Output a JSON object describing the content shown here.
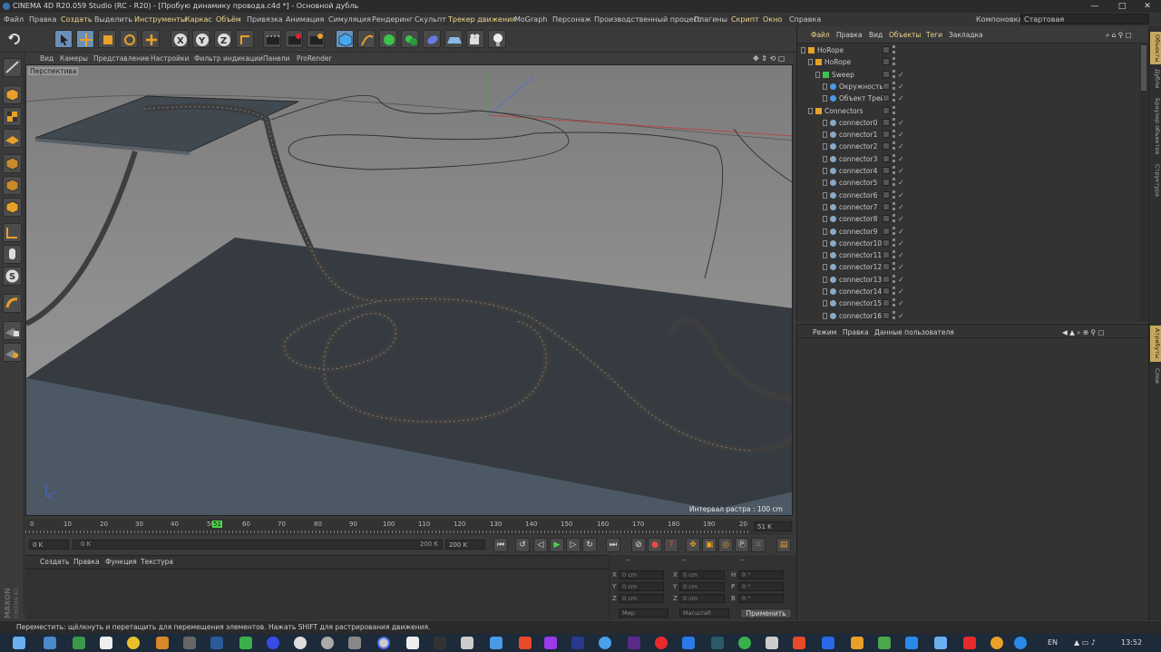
{
  "window": {
    "title": "CINEMA 4D R20.059 Studio (RC - R20) - [Пробую динамику провода.c4d *] - Основной дубль",
    "controls": [
      "—",
      "□",
      "✕"
    ]
  },
  "menu": {
    "items": [
      "Файл",
      "Правка",
      "Создать",
      "Выделить",
      "Инструменты",
      "Каркас",
      "Объём",
      "Привязка",
      "Анимация",
      "Симуляция",
      "Рендеринг",
      "Скульпт",
      "Трекер движения",
      "MoGraph",
      "Персонаж",
      "Производственный процесс",
      "Плагины",
      "Скрипт",
      "Окно",
      "Справка"
    ],
    "layout_label": "Компоновка",
    "layout_value": "Стартовая"
  },
  "viewport": {
    "menu": [
      "Вид",
      "Камеры",
      "Представление",
      "Настройки",
      "Фильтр индикации",
      "Панели",
      "ProRender"
    ],
    "label": "Перспектива",
    "grid_label": "Интервал растра : 100 cm"
  },
  "timeline": {
    "ticks": [
      "0",
      "10",
      "20",
      "30",
      "40",
      "50",
      "51",
      "60",
      "70",
      "80",
      "90",
      "100",
      "110",
      "120",
      "130",
      "140",
      "150",
      "160",
      "170",
      "180",
      "190",
      "20"
    ],
    "current_frame": "51 K",
    "start_field": "0 K",
    "range_start": "0 K",
    "range_end": "200 K",
    "end_field": "200 K"
  },
  "material_menu": [
    "Создать",
    "Правка",
    "Функция",
    "Текстура"
  ],
  "coords": {
    "header": [
      "--",
      "--",
      "--"
    ],
    "rows": [
      {
        "a": "X",
        "v1": "0 cm",
        "b": "X",
        "v2": "0 cm",
        "c": "H",
        "v3": "0 °"
      },
      {
        "a": "Y",
        "v1": "0 cm",
        "b": "Y",
        "v2": "0 cm",
        "c": "P",
        "v3": "0 °"
      },
      {
        "a": "Z",
        "v1": "0 cm",
        "b": "Z",
        "v2": "0 cm",
        "c": "B",
        "v3": "0 °"
      }
    ],
    "mode_world": "Мир",
    "mode_scale": "Масштаб",
    "apply": "Применить"
  },
  "objects": {
    "menu": [
      "Файл",
      "Правка",
      "Вид",
      "Объекты",
      "Теги",
      "Закладка"
    ],
    "rows": [
      {
        "name": "HoRope",
        "indent": 0
      },
      {
        "name": "HoRope",
        "indent": 1
      },
      {
        "name": "Sweep",
        "indent": 2
      },
      {
        "name": "Окружность",
        "indent": 3
      },
      {
        "name": "Объект Трей",
        "indent": 3
      },
      {
        "name": "Connectors",
        "indent": 1
      },
      {
        "name": "connector0",
        "indent": 3
      },
      {
        "name": "connector1",
        "indent": 3
      },
      {
        "name": "connector2",
        "indent": 3
      },
      {
        "name": "connector3",
        "indent": 3
      },
      {
        "name": "connector4",
        "indent": 3
      },
      {
        "name": "connector5",
        "indent": 3
      },
      {
        "name": "connector6",
        "indent": 3
      },
      {
        "name": "connector7",
        "indent": 3
      },
      {
        "name": "connector8",
        "indent": 3
      },
      {
        "name": "connector9",
        "indent": 3
      },
      {
        "name": "connector10",
        "indent": 3
      },
      {
        "name": "connector11",
        "indent": 3
      },
      {
        "name": "connector12",
        "indent": 3
      },
      {
        "name": "connector13",
        "indent": 3
      },
      {
        "name": "connector14",
        "indent": 3
      },
      {
        "name": "connector15",
        "indent": 3
      },
      {
        "name": "connector16",
        "indent": 3
      }
    ]
  },
  "attributes": {
    "menu": [
      "Режим",
      "Правка",
      "Данные пользователя"
    ]
  },
  "right_tabs": [
    "Объекты",
    "Дубли",
    "Браузер объектов",
    "Структура",
    "Атрибуты",
    "Слои"
  ],
  "status": "Переместить: щёлкнуть и перетащить для перемещения элементов. Нажать SHIFT для растрирования движения.",
  "tray": {
    "lang": "EN",
    "time": "13:52"
  },
  "brand": {
    "maxon": "MAXON",
    "c4d": "CINEMA 4D"
  }
}
